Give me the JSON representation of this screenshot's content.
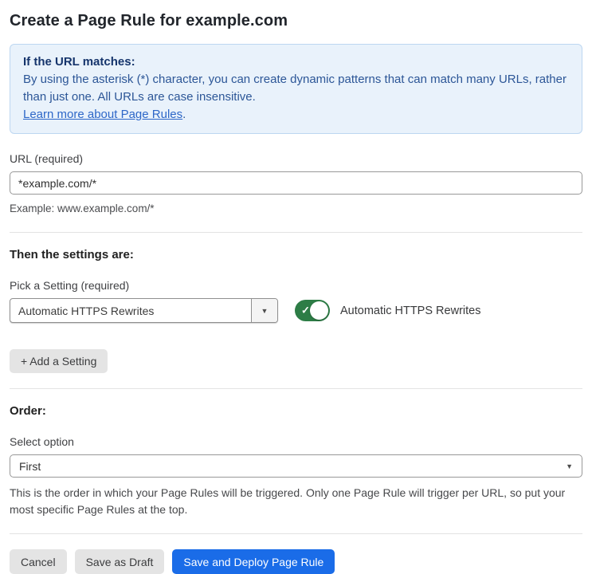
{
  "page": {
    "title": "Create a Page Rule for example.com"
  },
  "info_box": {
    "heading": "If the URL matches:",
    "body": "By using the asterisk (*) character, you can create dynamic patterns that can match many URLs, rather than just one. All URLs are case insensitive.",
    "link_label": "Learn more about Page Rules",
    "link_suffix": "."
  },
  "url_field": {
    "label": "URL (required)",
    "value": "*example.com/*",
    "help": "Example: www.example.com/*"
  },
  "settings_section": {
    "heading": "Then the settings are:",
    "picker_label": "Pick a Setting (required)",
    "picker_value": "Automatic HTTPS Rewrites",
    "picker_arrow": "▼",
    "toggle_state": "on",
    "toggle_check": "✓",
    "toggle_label": "Automatic HTTPS Rewrites",
    "add_button_label": "+ Add a Setting"
  },
  "order_section": {
    "heading": "Order:",
    "select_label": "Select option",
    "select_value": "First",
    "select_arrow": "▼",
    "help": "This is the order in which your Page Rules will be triggered. Only one Page Rule will trigger per URL, so put your most specific Page Rules at the top."
  },
  "footer": {
    "cancel_label": "Cancel",
    "save_draft_label": "Save as Draft",
    "save_deploy_label": "Save and Deploy Page Rule"
  },
  "colors": {
    "accent_blue": "#1a6ce8",
    "toggle_green": "#2d7d46",
    "info_bg": "#e9f2fb",
    "info_border": "#bdd7f1",
    "info_heading_text": "#16356c",
    "info_body_text": "#2c5697",
    "link_text": "#2d67c8",
    "button_gray": "#e4e4e4"
  }
}
